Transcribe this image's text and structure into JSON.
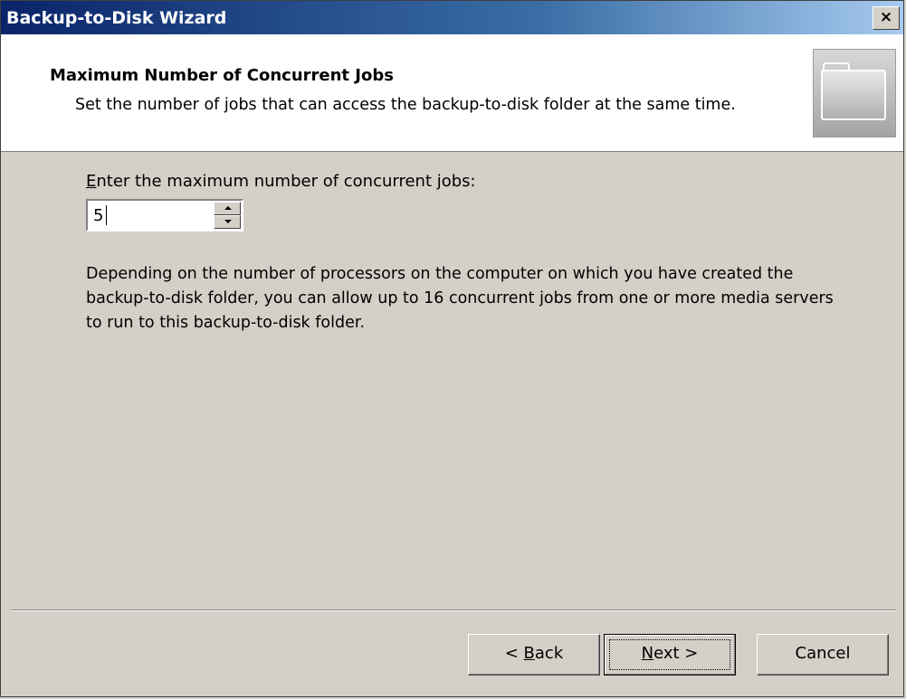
{
  "window": {
    "title": "Backup-to-Disk Wizard",
    "close_glyph": "×"
  },
  "header": {
    "title": "Maximum Number of Concurrent Jobs",
    "subtitle": "Set the number of jobs that can access the backup-to-disk folder at the same time.",
    "icon": "folder-icon"
  },
  "content": {
    "prompt_accel": "E",
    "prompt_rest": "nter the maximum number of concurrent jobs:",
    "jobs_value": "5",
    "description": "Depending on the number of processors on the computer on which you have created the backup-to-disk folder, you can allow up to 16 concurrent jobs from one or more media servers to run to this backup-to-disk folder."
  },
  "buttons": {
    "back_prefix": "< ",
    "back_accel": "B",
    "back_rest": "ack",
    "next_accel": "N",
    "next_rest": "ext >",
    "cancel": "Cancel"
  },
  "colors": {
    "dialog_bg": "#d4d0c8",
    "titlebar_start": "#0a246a",
    "titlebar_end": "#a6caf0"
  }
}
